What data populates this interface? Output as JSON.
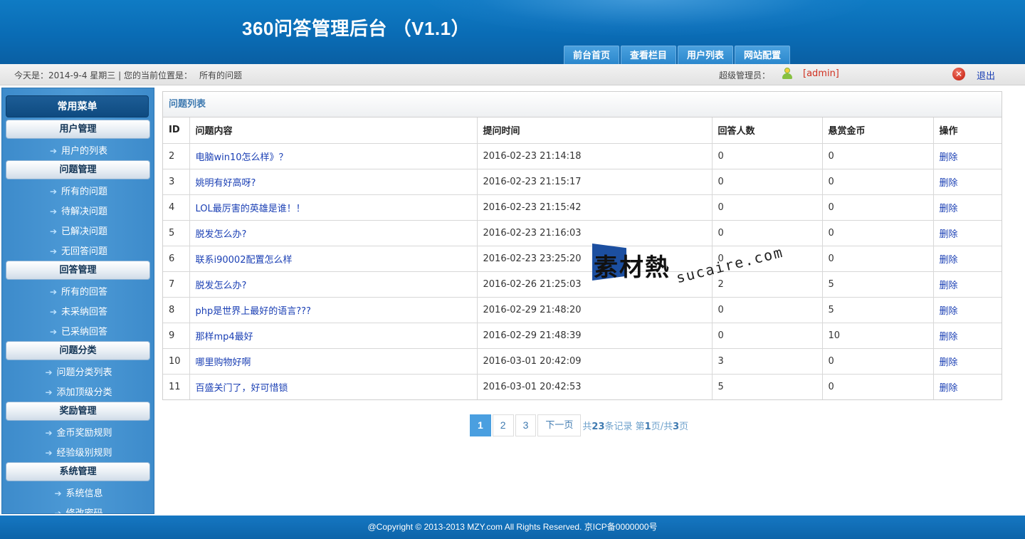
{
  "header": {
    "title": "360问答管理后台 （V1.1）",
    "tabs": [
      "前台首页",
      "查看栏目",
      "用户列表",
      "网站配置"
    ]
  },
  "statusbar": {
    "date_text": "今天是：2014-9-4 星期三 | 您的当前位置是：",
    "location": "所有的问题",
    "role_label": "超级管理员：",
    "username": "[admin]",
    "logout_label": "退出"
  },
  "sidebar": {
    "heading": "常用菜单",
    "groups": [
      {
        "title": "用户管理",
        "items": [
          "用户的列表"
        ]
      },
      {
        "title": "问题管理",
        "items": [
          "所有的问题",
          "待解决问题",
          "已解决问题",
          "无回答问题"
        ]
      },
      {
        "title": "回答管理",
        "items": [
          "所有的回答",
          "未采纳回答",
          "已采纳回答"
        ]
      },
      {
        "title": "问题分类",
        "items": [
          "问题分类列表",
          "添加顶级分类"
        ]
      },
      {
        "title": "奖励管理",
        "items": [
          "金币奖励规则",
          "经验级别规则"
        ]
      },
      {
        "title": "系统管理",
        "items": [
          "系统信息",
          "修改密码"
        ]
      }
    ]
  },
  "panel": {
    "title": "问题列表",
    "columns": [
      "ID",
      "问题内容",
      "提问时间",
      "回答人数",
      "悬赏金币",
      "操作"
    ],
    "rows": [
      {
        "id": "2",
        "content": "电脑win10怎么样》？",
        "time": "2016-02-23 21:14:18",
        "answers": "0",
        "coins": "0",
        "action": "删除"
      },
      {
        "id": "3",
        "content": "姚明有好高呀?",
        "time": "2016-02-23 21:15:17",
        "answers": "0",
        "coins": "0",
        "action": "删除"
      },
      {
        "id": "4",
        "content": "LOL最厉害的英雄是谁！！",
        "time": "2016-02-23 21:15:42",
        "answers": "0",
        "coins": "0",
        "action": "删除"
      },
      {
        "id": "5",
        "content": "脱发怎么办?",
        "time": "2016-02-23 21:16:03",
        "answers": "0",
        "coins": "0",
        "action": "删除"
      },
      {
        "id": "6",
        "content": "联系i90002配置怎么样",
        "time": "2016-02-23 23:25:20",
        "answers": "0",
        "coins": "0",
        "action": "删除"
      },
      {
        "id": "7",
        "content": "脱发怎么办?",
        "time": "2016-02-26 21:25:03",
        "answers": "2",
        "coins": "5",
        "action": "删除"
      },
      {
        "id": "8",
        "content": "php是世界上最好的语言???",
        "time": "2016-02-29 21:48:20",
        "answers": "0",
        "coins": "5",
        "action": "删除"
      },
      {
        "id": "9",
        "content": "那样mp4最好",
        "time": "2016-02-29 21:48:39",
        "answers": "0",
        "coins": "10",
        "action": "删除"
      },
      {
        "id": "10",
        "content": "哪里购物好啊",
        "time": "2016-03-01 20:42:09",
        "answers": "3",
        "coins": "0",
        "action": "删除"
      },
      {
        "id": "11",
        "content": "百盛关门了，好可惜锁",
        "time": "2016-03-01 20:42:53",
        "answers": "5",
        "coins": "0",
        "action": "删除"
      }
    ]
  },
  "pager": {
    "pages": [
      "1",
      "2",
      "3"
    ],
    "current": "1",
    "next_label": "下一页",
    "info_prefix": "共",
    "total_records": "23",
    "info_mid": "条记录 第",
    "current_page": "1",
    "info_mid2": "页/共",
    "total_pages": "3",
    "info_suffix": "页"
  },
  "footer": {
    "copyright": "@Copyright © 2013-2013 MZY.com All Rights Reserved. 京ICP备0000000号"
  },
  "watermark": {
    "brand_text": "素材熱",
    "url": "sucaire.com"
  },
  "colors": {
    "header_blue": "#0a6cb5",
    "sidebar_blue": "#4d9ad6",
    "link_blue": "#1a3fb4",
    "username_red": "#d03020",
    "pager_active": "#4a9fe0"
  }
}
